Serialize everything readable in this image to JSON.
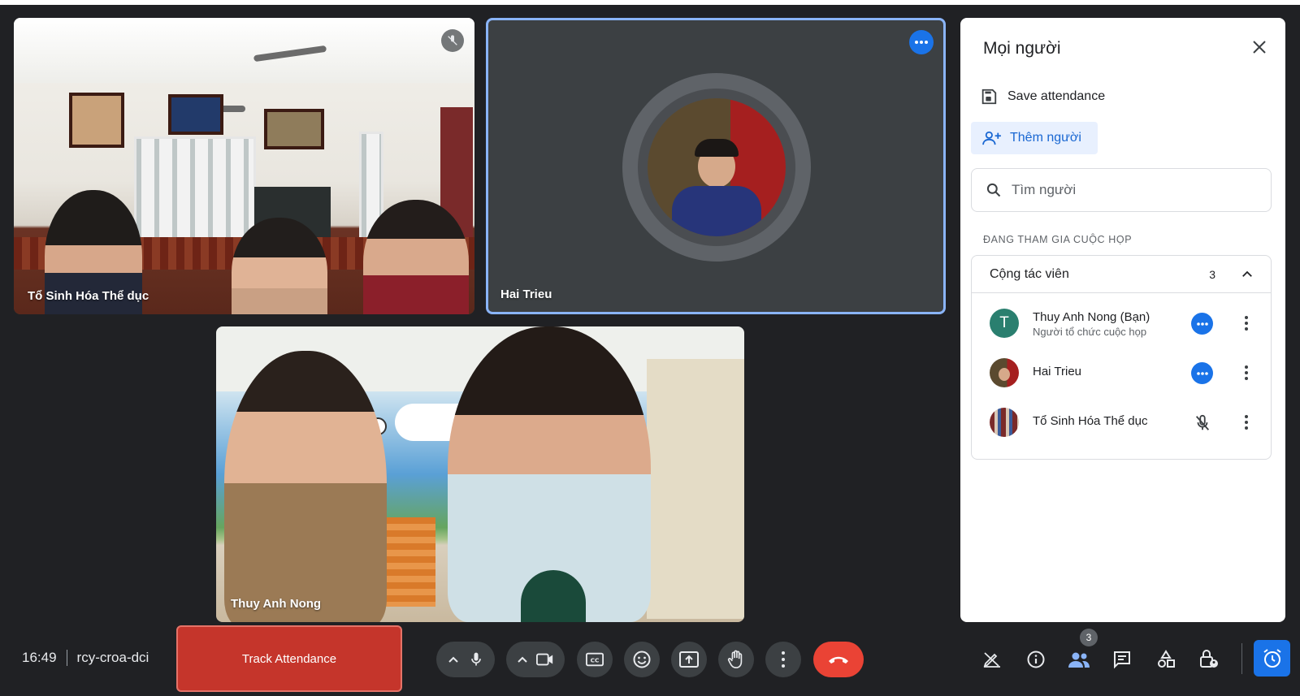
{
  "tiles": {
    "classroom": {
      "name": "Tổ Sinh Hóa Thể dục"
    },
    "hai_trieu": {
      "name": "Hai Trieu"
    },
    "thuy_anh": {
      "name": "Thuy Anh Nong"
    }
  },
  "panel": {
    "title": "Mọi người",
    "save_attendance": "Save attendance",
    "add_people": "Thêm người",
    "search_placeholder": "Tìm người",
    "section_label": "ĐANG THAM GIA CUỘC HỌP",
    "group": {
      "title": "Cộng tác viên",
      "count": "3",
      "participants": [
        {
          "name": "Thuy Anh Nong (Bạn)",
          "subtitle": "Người tổ chức cuộc họp",
          "initial": "T",
          "avatar_color": "#2a7f6f"
        },
        {
          "name": "Hai Trieu"
        },
        {
          "name": "Tổ Sinh Hóa Thể dục"
        }
      ]
    }
  },
  "bottom": {
    "time": "16:49",
    "meeting_code": "rcy-croa-dci",
    "track_attendance": "Track Attendance",
    "people_count": "3"
  },
  "colors": {
    "accent": "#1a73e8",
    "end_call": "#ea4335",
    "track_button": "#c5352b",
    "background": "#202124"
  }
}
